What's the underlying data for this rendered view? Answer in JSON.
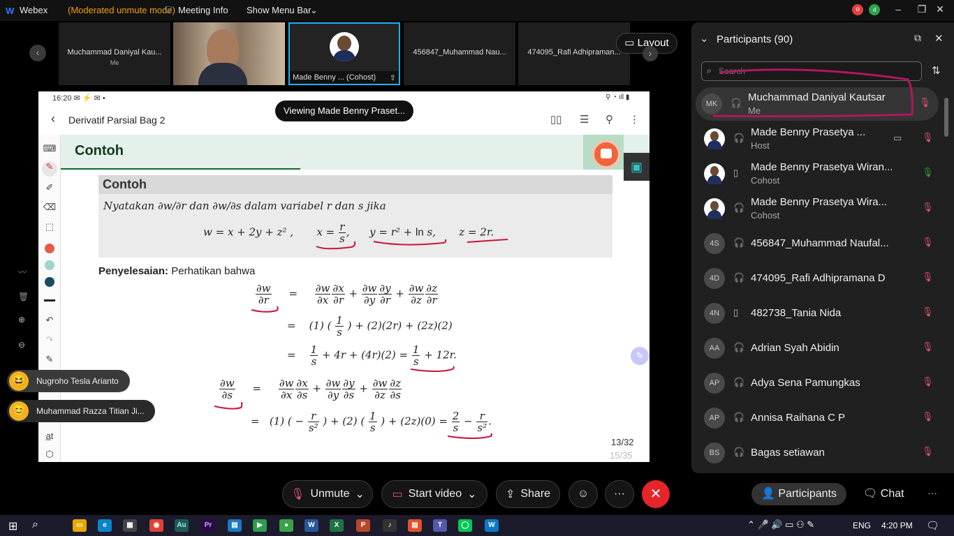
{
  "window": {
    "app_name": "Webex",
    "mode": "(Moderated unmute mode)",
    "meeting_info": "Meeting Info",
    "show_menu_bar": "Show Menu Bar"
  },
  "filmstrip": {
    "tiles": [
      {
        "name": "Muchammad Daniyal Kau...",
        "sub": "Me"
      },
      {
        "name": "",
        "sub": ""
      },
      {
        "name": "Made Benny ...  (Cohost)",
        "sub": ""
      },
      {
        "name": "456847_Muhammad Nau...",
        "sub": ""
      },
      {
        "name": "474095_Rafi Adhipraman...",
        "sub": ""
      }
    ],
    "layout_label": "Layout"
  },
  "share": {
    "viewing_label": "Viewing Made Benny Praset...",
    "status_time": "16:20",
    "doc_title": "Derivatif Parsial Bag 2",
    "slide_header": "Contoh",
    "box_title": "Contoh",
    "problem_text": "Nyatakan ∂w/∂r dan ∂w/∂s dalam variabel r dan s jika",
    "solution_label": "Penyelesaian:",
    "solution_text": "Perhatikan bahwa",
    "page_current": "13/32",
    "page_total": "15/35"
  },
  "floating_names": [
    {
      "name": "Nugroho Tesla Arianto"
    },
    {
      "name": "Muhammad Razza Titian Ji..."
    }
  ],
  "bottom_bar": {
    "unmute": "Unmute",
    "start_video": "Start video",
    "share": "Share",
    "participants": "Participants",
    "chat": "Chat"
  },
  "participants": {
    "title": "Participants (90)",
    "search_placeholder": "Search",
    "list": [
      {
        "initials": "MK",
        "name": "Muchammad Daniyal Kautsar",
        "role": "Me"
      },
      {
        "initials": "",
        "name": "Made Benny Prasetya ...",
        "role": "Host"
      },
      {
        "initials": "",
        "name": "Made Benny Prasetya Wiran...",
        "role": "Cohost"
      },
      {
        "initials": "",
        "name": "Made Benny Prasetya Wira...",
        "role": "Cohost"
      },
      {
        "initials": "4S",
        "name": "456847_Muhammad Naufal...",
        "role": ""
      },
      {
        "initials": "4D",
        "name": "474095_Rafi Adhipramana D",
        "role": ""
      },
      {
        "initials": "4N",
        "name": "482738_Tania Nida",
        "role": ""
      },
      {
        "initials": "AA",
        "name": "Adrian Syah Abidin",
        "role": ""
      },
      {
        "initials": "AP",
        "name": "Adya Sena Pamungkas",
        "role": ""
      },
      {
        "initials": "AP",
        "name": "Annisa Raihana C P",
        "role": ""
      },
      {
        "initials": "BS",
        "name": "Bagas setiawan",
        "role": ""
      }
    ]
  },
  "taskbar": {
    "language": "ENG",
    "time": "4:20 PM"
  },
  "colors": {
    "accent_red": "#e5252a",
    "annotation": "#c8143c",
    "highlight_pen": "#b0185f",
    "slide_header_green": "#0f3b1e"
  }
}
